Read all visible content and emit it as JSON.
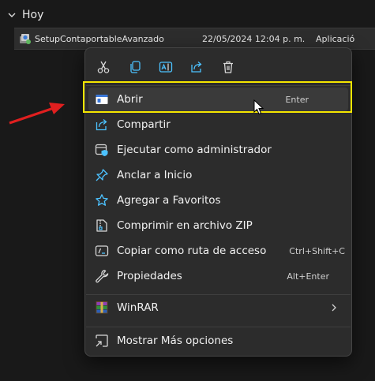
{
  "group": {
    "title": "Hoy"
  },
  "file": {
    "name": "SetupContaportableAvanzado",
    "date": "22/05/2024 12:04 p. m.",
    "type": "Aplicació"
  },
  "toolbar": [
    {
      "name": "cut",
      "icon": "scissors-icon"
    },
    {
      "name": "copy",
      "icon": "copy-icon"
    },
    {
      "name": "rename",
      "icon": "rename-icon"
    },
    {
      "name": "share",
      "icon": "share-icon"
    },
    {
      "name": "delete",
      "icon": "trash-icon"
    }
  ],
  "menu": {
    "items": [
      {
        "label": "Abrir",
        "shortcut": "Enter",
        "icon": "app-window-icon"
      },
      {
        "label": "Compartir",
        "shortcut": "",
        "icon": "share-icon"
      },
      {
        "label": "Ejecutar como administrador",
        "shortcut": "",
        "icon": "shield-window-icon"
      },
      {
        "label": "Anclar a Inicio",
        "shortcut": "",
        "icon": "pin-icon"
      },
      {
        "label": "Agregar a Favoritos",
        "shortcut": "",
        "icon": "star-icon"
      },
      {
        "label": "Comprimir en archivo ZIP",
        "shortcut": "",
        "icon": "zip-icon"
      },
      {
        "label": "Copiar como ruta de acceso",
        "shortcut": "Ctrl+Shift+C",
        "icon": "path-icon"
      },
      {
        "label": "Propiedades",
        "shortcut": "Alt+Enter",
        "icon": "wrench-icon"
      },
      {
        "label": "WinRAR",
        "shortcut": "",
        "icon": "winrar-icon"
      },
      {
        "label": "Mostrar Más opciones",
        "shortcut": "",
        "icon": "more-options-icon"
      }
    ]
  },
  "colors": {
    "background": "#191919",
    "menu": "#2c2c2c",
    "hover": "#3a3a3a",
    "accent": "#4cc2ff",
    "highlight_box": "#f5e600",
    "annotation_arrow": "#e01f1f"
  }
}
